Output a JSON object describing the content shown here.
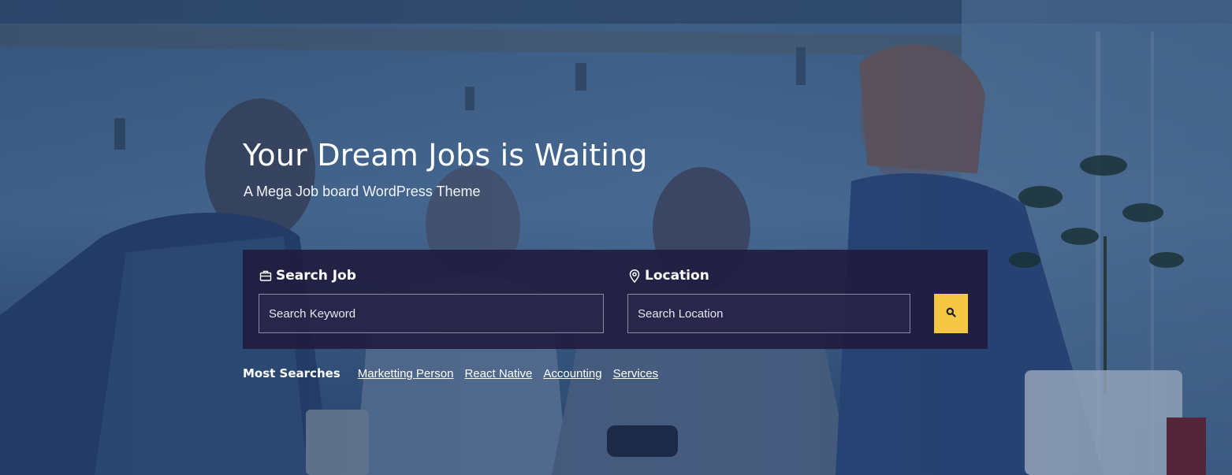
{
  "hero": {
    "title": "Your Dream Jobs is Waiting",
    "subtitle": "A Mega Job board WordPress Theme"
  },
  "search": {
    "job_label": "Search Job",
    "job_icon": "briefcase-icon",
    "keyword_placeholder": "Search Keyword",
    "location_label": "Location",
    "location_icon": "map-pin-icon",
    "location_placeholder": "Search Location",
    "button_icon": "search-icon"
  },
  "most_searches": {
    "label": "Most Searches",
    "links": [
      {
        "label": "Marketting Person"
      },
      {
        "label": "React Native"
      },
      {
        "label": "Accounting"
      },
      {
        "label": "Services"
      }
    ]
  },
  "colors": {
    "search_button": "#f6c744",
    "search_panel": "#201c3e",
    "text": "#ffffff"
  }
}
